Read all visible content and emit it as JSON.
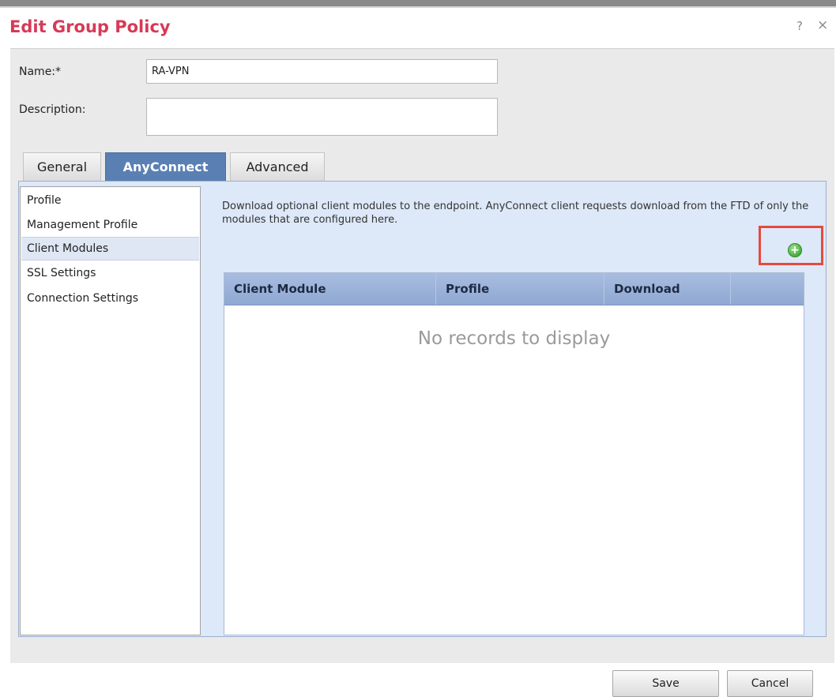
{
  "dialog": {
    "title": "Edit Group Policy",
    "help": "?",
    "close": "×"
  },
  "form": {
    "name_label": "Name:*",
    "name_value": "RA-VPN",
    "description_label": "Description:",
    "description_value": ""
  },
  "tabs": [
    {
      "label": "General",
      "active": false
    },
    {
      "label": "AnyConnect",
      "active": true
    },
    {
      "label": "Advanced",
      "active": false
    }
  ],
  "sidebar": {
    "items": [
      {
        "label": "Profile",
        "selected": false
      },
      {
        "label": "Management Profile",
        "selected": false
      },
      {
        "label": "Client Modules",
        "selected": true
      },
      {
        "label": "SSL Settings",
        "selected": false
      },
      {
        "label": "Connection Settings",
        "selected": false
      }
    ]
  },
  "main": {
    "description": "Download optional client modules to the endpoint. AnyConnect client requests download from the FTD of only the modules that are configured here.",
    "add_icon": "add-circle-icon",
    "table": {
      "columns": [
        "Client Module",
        "Profile",
        "Download",
        ""
      ],
      "rows": [],
      "empty_text": "No records to display"
    }
  },
  "footer": {
    "save_label": "Save",
    "cancel_label": "Cancel"
  },
  "colors": {
    "title": "#d63a57",
    "active_tab": "#5a80b3",
    "highlight_box": "#e34b3f",
    "add_icon": "#3fa83a"
  }
}
